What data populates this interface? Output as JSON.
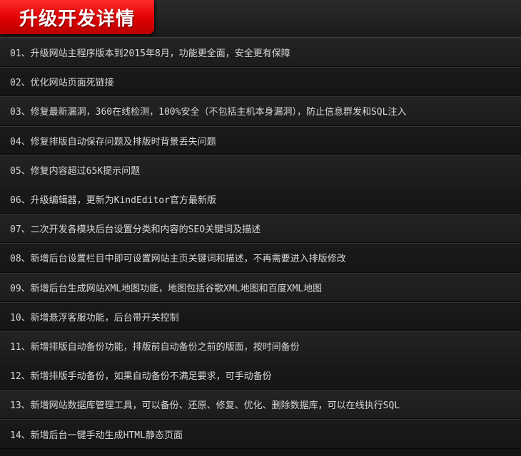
{
  "header": {
    "title": "升级开发详情"
  },
  "items": [
    "01、升级网站主程序版本到2015年8月，功能更全面，安全更有保障",
    "02、优化网站页面死链接",
    "03、修复最新漏洞，360在线检测，100%安全（不包括主机本身漏洞），防止信息群发和SQL注入",
    "04、修复排版自动保存问题及排版时背景丢失问题",
    "05、修复内容超过65K提示问题",
    "06、升级编辑器，更新为KindEditor官方最新版",
    "07、二次开发各模块后台设置分类和内容的SEO关键词及描述",
    "08、新增后台设置栏目中即可设置网站主页关键词和描述，不再需要进入排版修改",
    "09、新增后台生成网站XML地图功能，地图包括谷歌XML地图和百度XML地图",
    "10、新增悬浮客服功能，后台带开关控制",
    "11、新增排版自动备份功能，排版前自动备份之前的版面，按时间备份",
    "12、新增排版手动备份，如果自动备份不满足要求，可手动备份",
    "13、新增网站数据库管理工具，可以备份、还原、修复、优化、删除数据库，可以在线执行SQL",
    "14、新增后台一键手动生成HTML静态页面"
  ]
}
